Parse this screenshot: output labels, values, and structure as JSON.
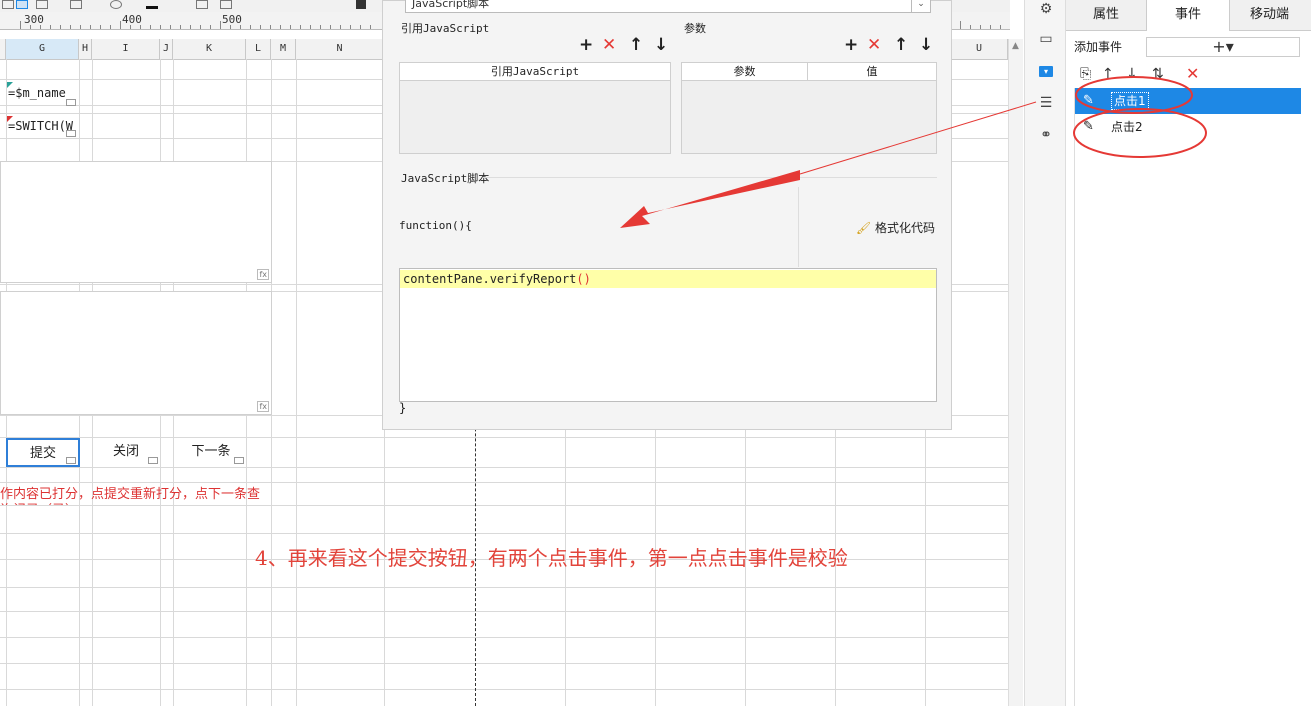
{
  "ruler": {
    "labels": [
      "300",
      "400",
      "500"
    ]
  },
  "columns": [
    "G",
    "H",
    "I",
    "J",
    "K",
    "L",
    "M",
    "N",
    "U"
  ],
  "cells": {
    "g1": "=$m_name",
    "g2": "=SWITCH(W",
    "submit": "提交",
    "close": "关闭",
    "next": "下一条",
    "note_line1": "作内容已打分，点提交重新打分，点下一条查",
    "note_line2": "询记录（录）",
    "fx": "fx"
  },
  "caption": "4、再来看这个提交按钮，有两个点击事件，第一点点击事件是校验",
  "dialog": {
    "script_type": "JavaScript脚本",
    "ref_section": "引用JavaScript",
    "param_section": "参数",
    "ref_table_header": "引用JavaScript",
    "param_header": "参数",
    "value_header": "值",
    "script_section": "JavaScript脚本",
    "fn_signature": "function(){",
    "format_button": "格式化代码",
    "code_line": "contentPane.verifyReport",
    "code_paren": "()",
    "close_brace": "}",
    "tool_add": "+",
    "tool_remove": "✕",
    "tool_up": "↑",
    "tool_down": "↓"
  },
  "panel": {
    "tabs": [
      "属性",
      "事件",
      "移动端"
    ],
    "active_tab": "事件",
    "add_event_label": "添加事件",
    "add_event_button": "+▾",
    "events": [
      {
        "label": "点击1",
        "selected": true
      },
      {
        "label": "点击2",
        "selected": false
      }
    ]
  },
  "colors": {
    "accent": "#1e88e5",
    "annotation": "#e2443b",
    "delete": "#e53935",
    "highlight": "#ffffa8"
  }
}
